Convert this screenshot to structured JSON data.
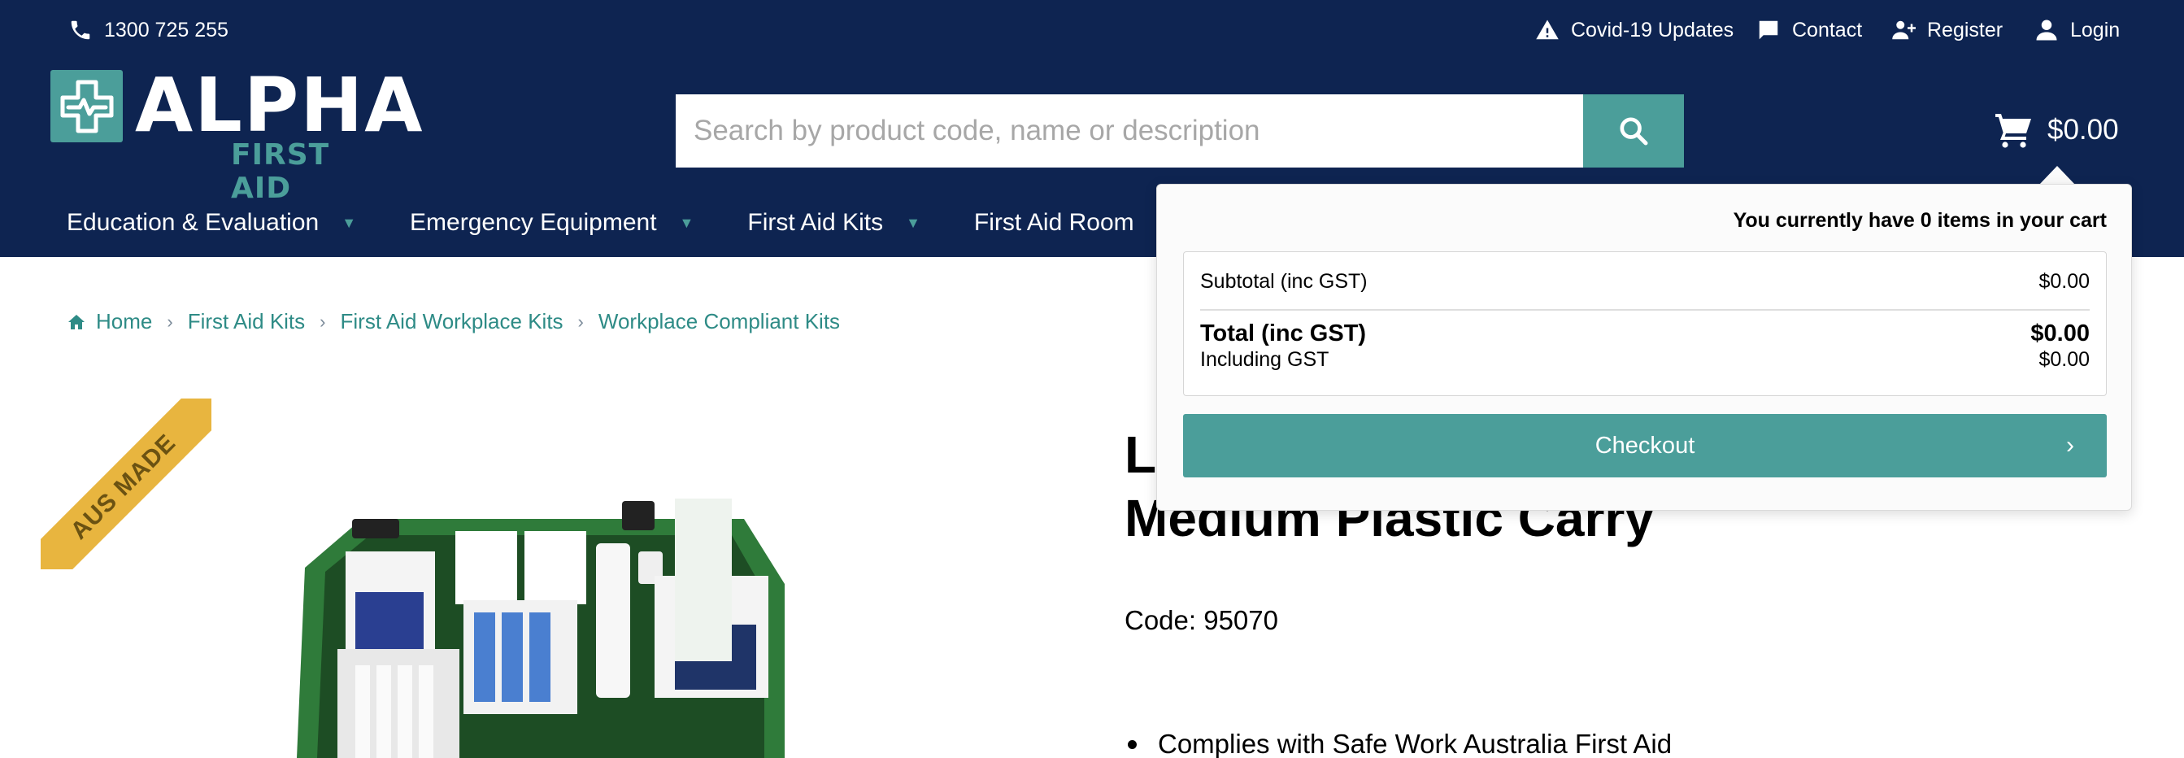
{
  "topbar": {
    "phone": "1300 725 255",
    "links": [
      {
        "label": "Covid-19 Updates",
        "icon": "warning-icon"
      },
      {
        "label": "Contact",
        "icon": "chat-icon"
      },
      {
        "label": "Register",
        "icon": "add-user-icon"
      },
      {
        "label": "Login",
        "icon": "user-icon"
      }
    ]
  },
  "logo": {
    "word": "ALPHA",
    "sub": "FIRST AID"
  },
  "search": {
    "placeholder": "Search by product code, name or description"
  },
  "cart": {
    "total": "$0.00"
  },
  "nav": {
    "items": [
      "Education & Evaluation",
      "Emergency Equipment",
      "First Aid Kits",
      "First Aid Room"
    ]
  },
  "breadcrumb": [
    "Home",
    "First Aid Kits",
    "First Aid Workplace Kits",
    "Workplace Compliant Kits"
  ],
  "badge": "AUS MADE",
  "product": {
    "title_line1": "Lo",
    "title_line2": "Medium Plastic Carry",
    "code": "Code: 95070",
    "bullet_1": "Complies with Safe Work Australia First Aid"
  },
  "minicart": {
    "message": "You currently have 0 items in your cart",
    "subtotal_label": "Subtotal (inc GST)",
    "subtotal_value": "$0.00",
    "total_label": "Total (inc GST)",
    "total_value": "$0.00",
    "gst_label": "Including GST",
    "gst_value": "$0.00",
    "checkout_label": "Checkout"
  },
  "colors": {
    "navy": "#0e2451",
    "teal": "#4b9e9a",
    "ribbon": "#e8b53f"
  }
}
